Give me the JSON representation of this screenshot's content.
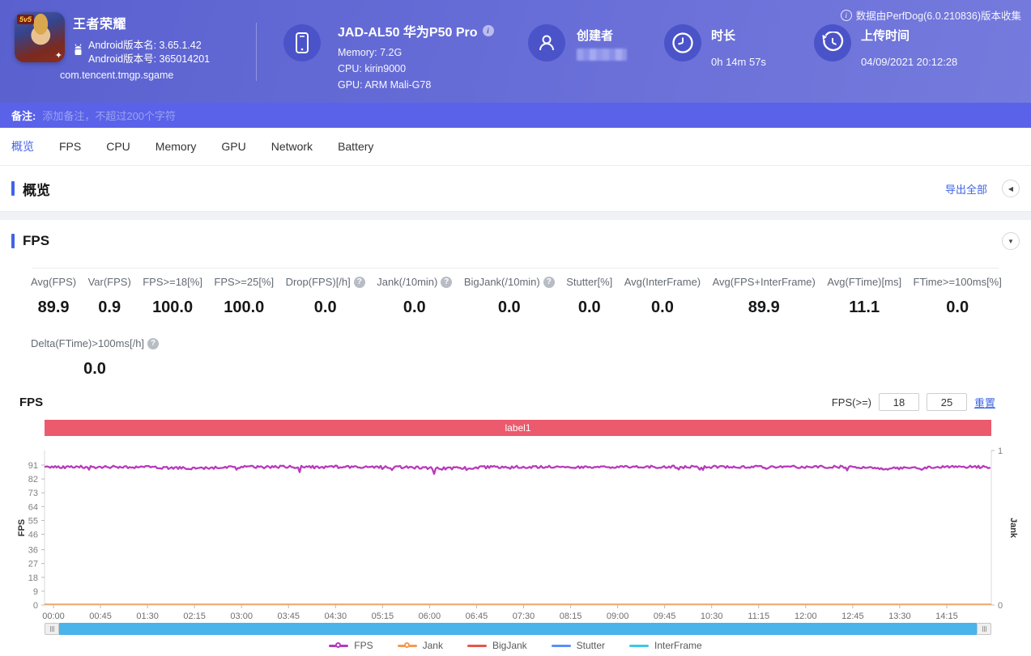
{
  "header": {
    "collect_info": "数据由PerfDog(6.0.210836)版本收集",
    "app": {
      "badge": "5v5",
      "name": "王者荣耀",
      "version_name": "Android版本名: 3.65.1.42",
      "version_code": "Android版本号: 365014201",
      "package": "com.tencent.tmgp.sgame"
    },
    "device": {
      "model": "JAD-AL50 华为P50 Pro",
      "memory": "Memory: 7.2G",
      "cpu": "CPU: kirin9000",
      "gpu": "GPU: ARM Mali-G78"
    },
    "creator": {
      "label": "创建者",
      "value_hidden": true
    },
    "duration": {
      "label": "时长",
      "value": "0h 14m 57s"
    },
    "upload": {
      "label": "上传时间",
      "value": "04/09/2021 20:12:28"
    }
  },
  "remark": {
    "label": "备注:",
    "placeholder": "添加备注，不超过200个字符"
  },
  "tabs": [
    {
      "label": "概览",
      "active": true
    },
    {
      "label": "FPS",
      "active": false
    },
    {
      "label": "CPU",
      "active": false
    },
    {
      "label": "Memory",
      "active": false
    },
    {
      "label": "GPU",
      "active": false
    },
    {
      "label": "Network",
      "active": false
    },
    {
      "label": "Battery",
      "active": false
    }
  ],
  "overview": {
    "title": "概览",
    "export_label": "导出全部",
    "collapse_glyph": "◀"
  },
  "fps_section": {
    "title": "FPS",
    "collapse_glyph": "▼",
    "stats": [
      {
        "label": "Avg(FPS)",
        "value": "89.9",
        "help": false
      },
      {
        "label": "Var(FPS)",
        "value": "0.9",
        "help": false
      },
      {
        "label": "FPS>=18[%]",
        "value": "100.0",
        "help": false
      },
      {
        "label": "FPS>=25[%]",
        "value": "100.0",
        "help": false
      },
      {
        "label": "Drop(FPS)[/h]",
        "value": "0.0",
        "help": true
      },
      {
        "label": "Jank(/10min)",
        "value": "0.0",
        "help": true
      },
      {
        "label": "BigJank(/10min)",
        "value": "0.0",
        "help": true
      },
      {
        "label": "Stutter[%]",
        "value": "0.0",
        "help": false
      },
      {
        "label": "Avg(InterFrame)",
        "value": "0.0",
        "help": false
      },
      {
        "label": "Avg(FPS+InterFrame)",
        "value": "89.9",
        "help": false
      },
      {
        "label": "Avg(FTime)[ms]",
        "value": "11.1",
        "help": false
      },
      {
        "label": "FTime>=100ms[%]",
        "value": "0.0",
        "help": false
      }
    ],
    "stats_row2": [
      {
        "label": "Delta(FTime)>100ms[/h]",
        "value": "0.0",
        "help": true
      }
    ],
    "chart_title": "FPS",
    "threshold": {
      "label": "FPS(>=)",
      "input1": "18",
      "input2": "25",
      "reset_label": "重置"
    }
  },
  "chart_data": {
    "type": "line",
    "title": "FPS",
    "banner_label": "label1",
    "grid": false,
    "legend_position": "bottom-center",
    "x_ticks": [
      "00:00",
      "00:45",
      "01:30",
      "02:15",
      "03:00",
      "03:45",
      "04:30",
      "05:15",
      "06:00",
      "06:45",
      "07:30",
      "08:15",
      "09:00",
      "09:45",
      "10:30",
      "11:15",
      "12:00",
      "12:45",
      "13:30",
      "14:15"
    ],
    "x_total_duration": "14m57s",
    "y_axis_left": {
      "label": "FPS",
      "ticks": [
        91,
        82,
        73,
        64,
        55,
        46,
        36,
        27,
        18,
        9,
        0
      ],
      "range": [
        0,
        96
      ]
    },
    "y_axis_right": {
      "label": "Jank",
      "ticks": [
        1,
        0
      ],
      "range": [
        0,
        1
      ]
    },
    "series": [
      {
        "name": "FPS",
        "color": "#b83abc",
        "marker": "circle",
        "avg": 89.9,
        "sampled_values": [
          90,
          90,
          90,
          89,
          90,
          90,
          90,
          90,
          89,
          90,
          90,
          90,
          90,
          90,
          90,
          90,
          90,
          89,
          90,
          90
        ],
        "noise_amplitude": 1.5,
        "occasional_dip_to": 86
      },
      {
        "name": "Jank",
        "color": "#f59a4e",
        "marker": "circle",
        "constant_value": 0
      },
      {
        "name": "BigJank",
        "color": "#e6544c",
        "marker": "line",
        "constant_value": 0
      },
      {
        "name": "Stutter",
        "color": "#5b8ff9",
        "marker": "line",
        "constant_value": 0
      },
      {
        "name": "InterFrame",
        "color": "#3ec7e6",
        "marker": "line",
        "constant_value": 0
      }
    ]
  }
}
